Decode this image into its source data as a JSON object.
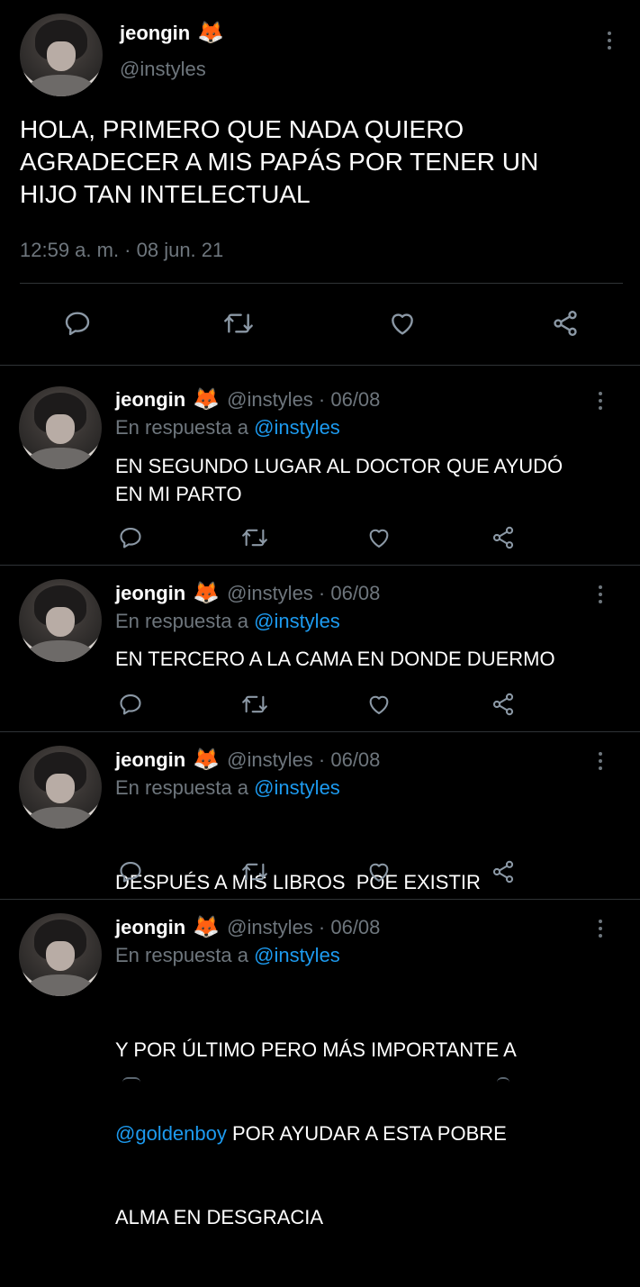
{
  "main_tweet": {
    "display_name": "jeongin",
    "handle": "@instyles",
    "name_emoji": "🦊",
    "text_lines": [
      "HOLA, PRIMERO QUE NADA QUIERO",
      "AGRADECER A MIS PAPÁS POR TENER UN",
      "HIJO TAN INTELECTUAL"
    ],
    "timestamp": "12:59 a. m. · 08 jun. 21"
  },
  "replies": [
    {
      "display_name": "jeongin",
      "name_emoji": "🦊",
      "handle_date": "@instyles · 06/08",
      "reply_prefix": "En respuesta a",
      "reply_to": "@instyles",
      "lines": [
        "EN SEGUNDO LUGAR AL DOCTOR QUE AYUDÓ",
        "EN MI PARTO"
      ]
    },
    {
      "display_name": "jeongin",
      "name_emoji": "🦊",
      "handle_date": "@instyles · 06/08",
      "reply_prefix": "En respuesta a",
      "reply_to": "@instyles",
      "lines": [
        "EN TERCERO A LA CAMA EN DONDE DUERMO"
      ]
    },
    {
      "display_name": "jeongin",
      "name_emoji": "🦊",
      "handle_date": "@instyles · 06/08",
      "reply_prefix": "En respuesta a",
      "reply_to": "@instyles",
      "lines": [
        "DESPUÉS A MIS LIBROS  POE EXISTIR"
      ]
    },
    {
      "display_name": "jeongin",
      "name_emoji": "🦊",
      "handle_date": "@instyles · 06/08",
      "reply_prefix": "En respuesta a",
      "reply_to": "@instyles",
      "line1": "Y POR ÚLTIMO PERO MÁS IMPORTANTE A",
      "mention": "@goldenboy",
      "line2_rest": " POR AYUDAR A ESTA POBRE",
      "line3": "ALMA EN DESGRACIA"
    }
  ],
  "colors": {
    "background": "#000000",
    "text": "#ffffff",
    "secondary": "#6e767d",
    "link": "#1d9bf0",
    "divider": "#2f3336"
  },
  "icons": [
    "reply-icon",
    "retweet-icon",
    "like-icon",
    "share-icon",
    "more-options-icon"
  ]
}
